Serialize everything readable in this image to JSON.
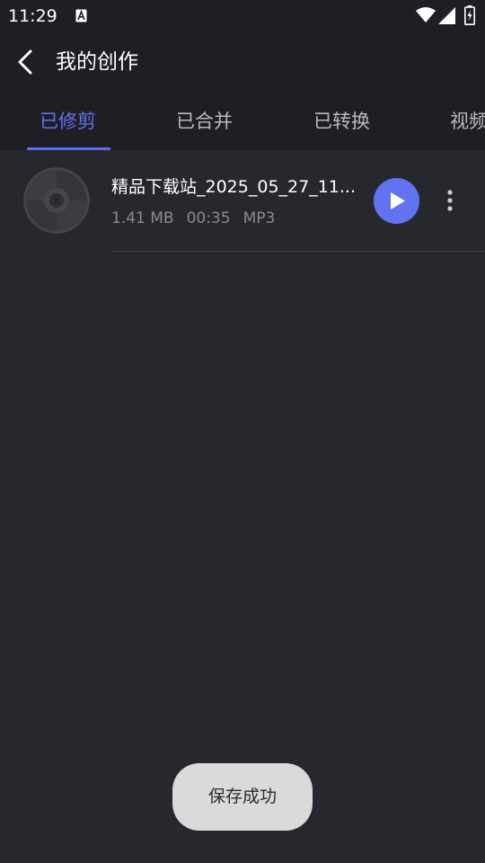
{
  "status_bar": {
    "time": "11:29",
    "icons": [
      "a-notification-icon",
      "wifi-icon",
      "signal-icon",
      "battery-charging-icon"
    ]
  },
  "header": {
    "back_icon": "chevron-left-icon",
    "title": "我的创作"
  },
  "tabs": [
    {
      "label": "已修剪",
      "active": true
    },
    {
      "label": "已合并",
      "active": false
    },
    {
      "label": "已转换",
      "active": false
    },
    {
      "label": "视频",
      "active": false
    }
  ],
  "items": [
    {
      "title": "精品下载站_2025_05_27_11...",
      "size": "1.41 MB",
      "duration": "00:35",
      "format": "MP3",
      "icon": "disc-icon"
    }
  ],
  "toast": {
    "text": "保存成功"
  },
  "colors": {
    "accent": "#6173f0",
    "background": "#27282e",
    "header_background": "#1e1e24",
    "toast_background": "#dadada"
  }
}
